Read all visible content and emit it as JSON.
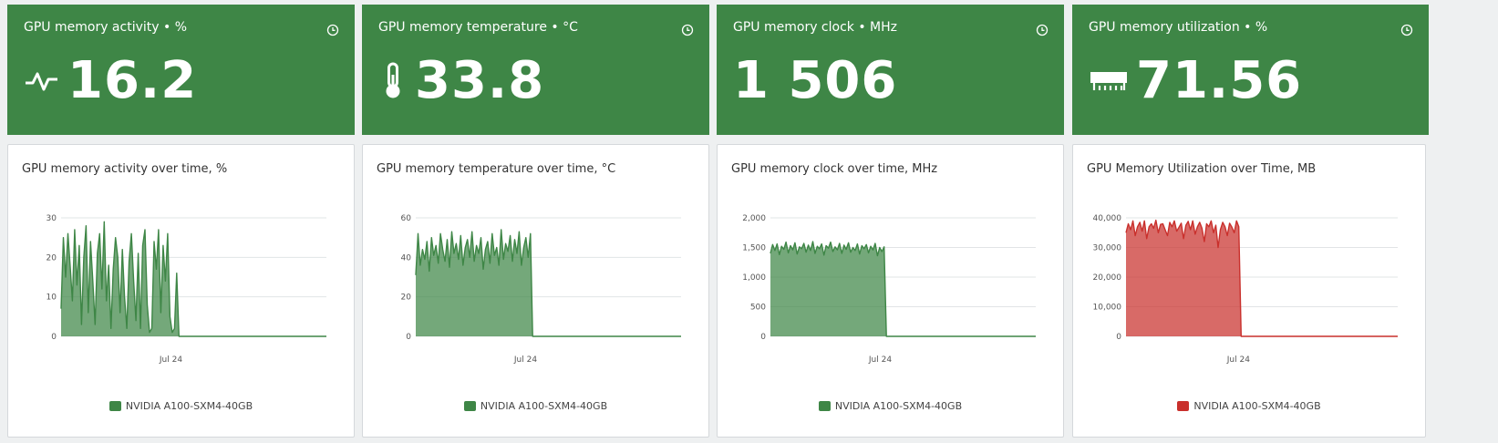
{
  "stats": [
    {
      "title": "GPU memory activity • %",
      "value": "16.2",
      "icon": "activity-pulse-icon"
    },
    {
      "title": "GPU memory temperature • °C",
      "value": "33.8",
      "icon": "thermometer-icon"
    },
    {
      "title": "GPU memory clock • MHz",
      "value": "1 506",
      "icon": ""
    },
    {
      "title": "GPU memory utilization • %",
      "value": "71.56",
      "icon": "memory-chip-icon"
    }
  ],
  "colors": {
    "tile_bg": "#3e8646",
    "series_green": "#3e8646",
    "series_red": "#c9302c"
  },
  "charts": [
    {
      "title": "GPU memory activity over time, %",
      "legend": "NVIDIA A100-SXM4-40GB",
      "chart_data": {
        "type": "area",
        "ylim": [
          0,
          30
        ],
        "yticks": [
          0,
          10,
          20,
          30
        ],
        "ytick_labels": [
          "0",
          "10",
          "20",
          "30"
        ],
        "xtick_labels": [
          "Jul 24"
        ],
        "series": [
          {
            "name": "NVIDIA A100-SXM4-40GB",
            "color": "#3e8646",
            "values": [
              7,
              25,
              15,
              26,
              18,
              9,
              27,
              13,
              23,
              3,
              20,
              28,
              6,
              24,
              14,
              3,
              21,
              26,
              12,
              29,
              9,
              18,
              2,
              17,
              25,
              20,
              6,
              22,
              10,
              2,
              19,
              26,
              14,
              4,
              21,
              2,
              23,
              27,
              8,
              1,
              2,
              24,
              17,
              27,
              6,
              23,
              14,
              26,
              5,
              1,
              2,
              16,
              0,
              0,
              0,
              0,
              0,
              0,
              0,
              0,
              0,
              0,
              0,
              0,
              0,
              0,
              0,
              0,
              0,
              0,
              0,
              0,
              0,
              0,
              0,
              0,
              0,
              0,
              0,
              0,
              0,
              0,
              0,
              0,
              0,
              0,
              0,
              0,
              0,
              0,
              0,
              0,
              0,
              0,
              0,
              0,
              0,
              0,
              0,
              0,
              0,
              0,
              0,
              0,
              0,
              0,
              0,
              0,
              0,
              0,
              0,
              0,
              0,
              0,
              0,
              0,
              0,
              0
            ]
          }
        ]
      }
    },
    {
      "title": "GPU memory temperature over time, °C",
      "legend": "NVIDIA A100-SXM4-40GB",
      "chart_data": {
        "type": "area",
        "ylim": [
          0,
          60
        ],
        "yticks": [
          0,
          20,
          40,
          60
        ],
        "ytick_labels": [
          "0",
          "20",
          "40",
          "60"
        ],
        "xtick_labels": [
          "Jul 24"
        ],
        "series": [
          {
            "name": "NVIDIA A100-SXM4-40GB",
            "color": "#3e8646",
            "values": [
              31,
              52,
              36,
              44,
              39,
              48,
              33,
              50,
              41,
              46,
              37,
              52,
              44,
              38,
              49,
              35,
              53,
              42,
              47,
              39,
              51,
              36,
              45,
              49,
              40,
              53,
              38,
              46,
              42,
              50,
              34,
              44,
              48,
              37,
              52,
              41,
              45,
              36,
              54,
              39,
              47,
              43,
              51,
              38,
              49,
              42,
              53,
              36,
              45,
              50,
              40,
              52,
              0,
              0,
              0,
              0,
              0,
              0,
              0,
              0,
              0,
              0,
              0,
              0,
              0,
              0,
              0,
              0,
              0,
              0,
              0,
              0,
              0,
              0,
              0,
              0,
              0,
              0,
              0,
              0,
              0,
              0,
              0,
              0,
              0,
              0,
              0,
              0,
              0,
              0,
              0,
              0,
              0,
              0,
              0,
              0,
              0,
              0,
              0,
              0,
              0,
              0,
              0,
              0,
              0,
              0,
              0,
              0,
              0,
              0,
              0,
              0,
              0,
              0,
              0,
              0,
              0,
              0,
              0
            ]
          }
        ]
      }
    },
    {
      "title": "GPU memory clock over time, MHz",
      "legend": "NVIDIA A100-SXM4-40GB",
      "chart_data": {
        "type": "area",
        "ylim": [
          0,
          2000
        ],
        "yticks": [
          0,
          500,
          1000,
          1500,
          2000
        ],
        "ytick_labels": [
          "0",
          "500",
          "1,000",
          "1,500",
          "2,000"
        ],
        "xtick_labels": [
          "Jul 24"
        ],
        "series": [
          {
            "name": "NVIDIA A100-SXM4-40GB",
            "color": "#3e8646",
            "values": [
              1400,
              1550,
              1450,
              1560,
              1380,
              1520,
              1470,
              1590,
              1410,
              1530,
              1460,
              1580,
              1390,
              1510,
              1480,
              1570,
              1420,
              1540,
              1450,
              1600,
              1400,
              1520,
              1480,
              1560,
              1370,
              1530,
              1490,
              1590,
              1430,
              1510,
              1460,
              1570,
              1400,
              1540,
              1470,
              1580,
              1420,
              1500,
              1450,
              1560,
              1390,
              1530,
              1480,
              1550,
              1410,
              1520,
              1460,
              1570,
              1360,
              1500,
              1430,
              1510,
              0,
              0,
              0,
              0,
              0,
              0,
              0,
              0,
              0,
              0,
              0,
              0,
              0,
              0,
              0,
              0,
              0,
              0,
              0,
              0,
              0,
              0,
              0,
              0,
              0,
              0,
              0,
              0,
              0,
              0,
              0,
              0,
              0,
              0,
              0,
              0,
              0,
              0,
              0,
              0,
              0,
              0,
              0,
              0,
              0,
              0,
              0,
              0,
              0,
              0,
              0,
              0,
              0,
              0,
              0,
              0,
              0,
              0,
              0,
              0,
              0,
              0,
              0,
              0,
              0,
              0,
              0,
              0
            ]
          }
        ]
      }
    },
    {
      "title": "GPU Memory Utilization over Time, MB",
      "legend": "NVIDIA A100-SXM4-40GB",
      "chart_data": {
        "type": "area",
        "ylim": [
          0,
          40000
        ],
        "yticks": [
          0,
          10000,
          20000,
          30000,
          40000
        ],
        "ytick_labels": [
          "0",
          "10,000",
          "20,000",
          "30,000",
          "40,000"
        ],
        "xtick_labels": [
          "Jul 24"
        ],
        "series": [
          {
            "name": "NVIDIA A100-SXM4-40GB",
            "color": "#c9302c",
            "values": [
              35000,
              38000,
              36000,
              39000,
              34000,
              37000,
              38500,
              35500,
              39000,
              33000,
              37000,
              38000,
              36500,
              39200,
              35000,
              37800,
              38000,
              36000,
              34000,
              38500,
              37000,
              39000,
              35500,
              36800,
              38200,
              33000,
              37500,
              38800,
              36000,
              39000,
              34500,
              37000,
              38500,
              36500,
              32000,
              38000,
              37000,
              39000,
              35000,
              37500,
              30000,
              36000,
              38500,
              37000,
              34000,
              38200,
              36800,
              35000,
              39000,
              37000,
              0,
              0,
              0,
              0,
              0,
              0,
              0,
              0,
              0,
              0,
              0,
              0,
              0,
              0,
              0,
              0,
              0,
              0,
              0,
              0,
              0,
              0,
              0,
              0,
              0,
              0,
              0,
              0,
              0,
              0,
              0,
              0,
              0,
              0,
              0,
              0,
              0,
              0,
              0,
              0,
              0,
              0,
              0,
              0,
              0,
              0,
              0,
              0,
              0,
              0,
              0,
              0,
              0,
              0,
              0,
              0,
              0,
              0,
              0,
              0,
              0,
              0,
              0,
              0,
              0,
              0,
              0,
              0,
              0
            ]
          }
        ]
      }
    }
  ]
}
